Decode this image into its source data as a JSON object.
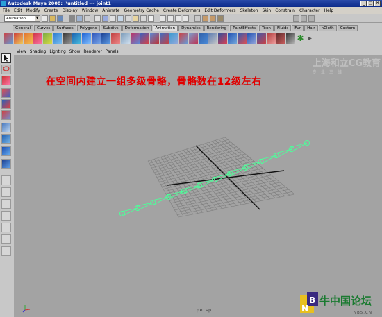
{
  "window": {
    "title": "Autodesk Maya 2008: .\\untitled    ---   joint1",
    "buttons": [
      "_",
      "□",
      "×"
    ]
  },
  "menubar": [
    "File",
    "Edit",
    "Modify",
    "Create",
    "Display",
    "Window",
    "Animate",
    "Geometry Cache",
    "Create Deformers",
    "Edit Deformers",
    "Skeleton",
    "Skin",
    "Constrain",
    "Character",
    "Help"
  ],
  "statusline": {
    "mode": "Animation"
  },
  "shelf": {
    "tabs": [
      "General",
      "Curves",
      "Surfaces",
      "Polygons",
      "Subdivs",
      "Deformation",
      "Animation",
      "Dynamics",
      "Rendering",
      "PaintEffects",
      "Toon",
      "Fluids",
      "Fur",
      "Hair",
      "nCloth",
      "Custom"
    ],
    "active_tab": "Animation"
  },
  "panel_menu": [
    "View",
    "Shading",
    "Lighting",
    "Show",
    "Renderer",
    "Panels"
  ],
  "viewport": {
    "annotation": "在空间内建立一组多级骨骼，骨骼数在12级左右",
    "camera": "persp",
    "watermark_line1": "上海和立CG教育",
    "watermark_line2": "专 业 三 维"
  },
  "logo": {
    "text": "牛中国论坛",
    "sub": "NB5.CN",
    "badge": "NB"
  },
  "colors": {
    "joint": "#4dff9a",
    "annotation": "#e00000",
    "grid": "#7c7c7c",
    "viewport_bg": "#a3a3a3",
    "titlebar": "#0b2a8a"
  },
  "icons": [
    "select-tool-icon",
    "lasso-icon",
    "paint-select-icon",
    "move-icon",
    "rotate-icon",
    "scale-icon",
    "manipulator-icon",
    "soft-mod-icon",
    "joint-tool-icon",
    "layout-single-icon",
    "layout-four-icon",
    "outliner-icon"
  ]
}
